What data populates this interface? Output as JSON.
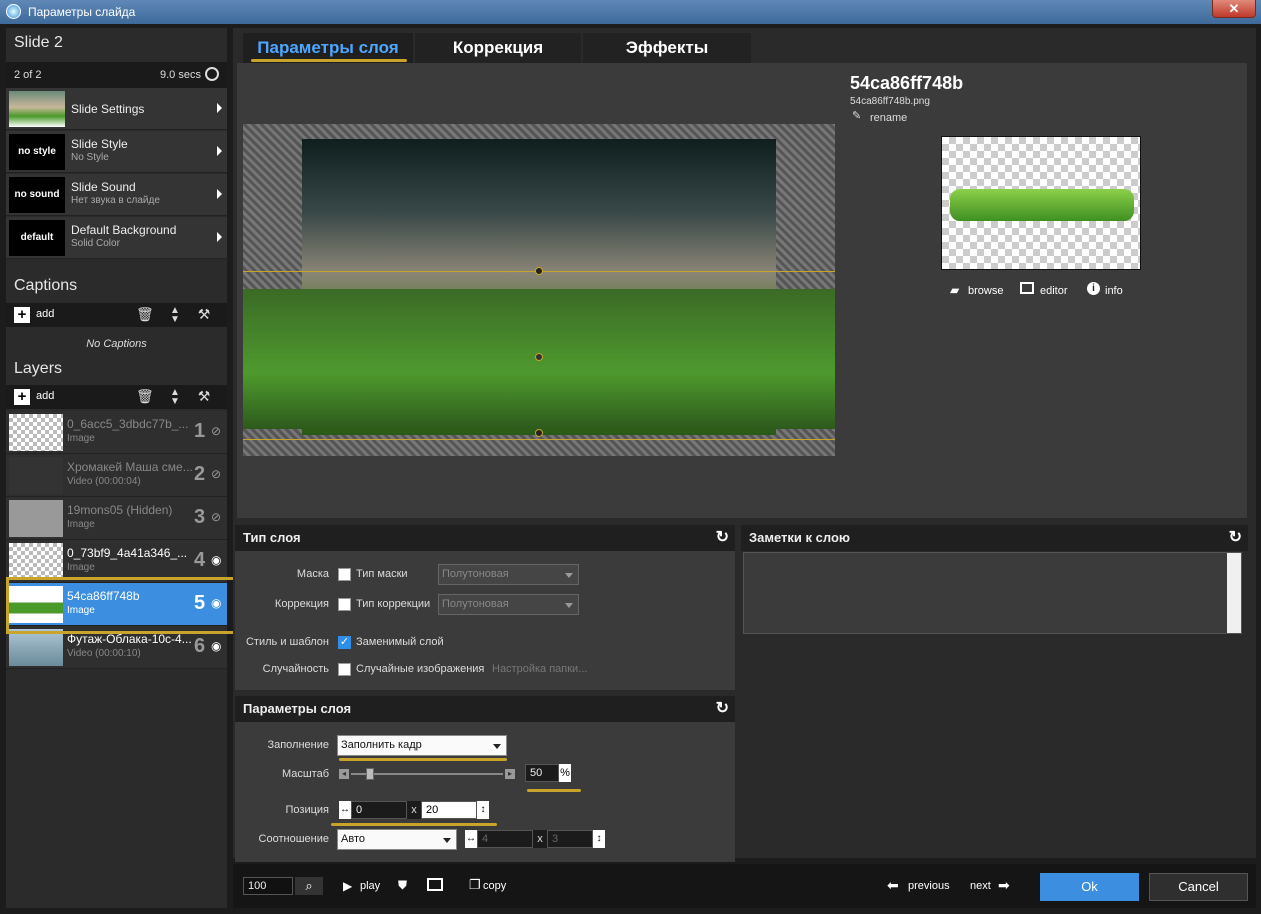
{
  "window": {
    "title": "Параметры слайда",
    "close": "✕"
  },
  "sidebar": {
    "slide_title": "Slide 2",
    "slide_index": "2 of 2",
    "slide_duration": "9.0 secs",
    "nav": [
      {
        "name": "Slide Settings",
        "sub": "",
        "thumb": ""
      },
      {
        "name": "Slide Style",
        "sub": "No Style",
        "thumb": "no style"
      },
      {
        "name": "Slide Sound",
        "sub": "Нет звука в слайде",
        "thumb": "no sound"
      },
      {
        "name": "Default Background",
        "sub": "Solid Color",
        "thumb": "default"
      }
    ],
    "captions_title": "Captions",
    "captions_add": "add",
    "captions_empty": "No Captions",
    "layers_title": "Layers",
    "layers_add": "add",
    "layers": [
      {
        "name": "0_6acc5_3dbdc77b_...",
        "type": "Image",
        "num": "1"
      },
      {
        "name": "Хромакей Маша сме...",
        "type": "Video (00:00:04)",
        "num": "2"
      },
      {
        "name": "19mons05 (Hidden)",
        "type": "Image",
        "num": "3"
      },
      {
        "name": "0_73bf9_4a41a346_...",
        "type": "Image",
        "num": "4"
      },
      {
        "name": "54ca86ff748b",
        "type": "Image",
        "num": "5"
      },
      {
        "name": "Футаж-Облака-10с-4...",
        "type": "Video (00:00:10)",
        "num": "6"
      }
    ]
  },
  "tabs": {
    "layer_params": "Параметры слоя",
    "correction": "Коррекция",
    "effects": "Эффекты"
  },
  "preview": {
    "title": "54ca86ff748b",
    "filename": "54ca86ff748b.png",
    "rename": "rename",
    "browse": "browse",
    "editor": "editor",
    "info": "info"
  },
  "layer_type": {
    "title": "Тип слоя",
    "mask_label": "Маска",
    "mask_check": "Тип маски",
    "mask_select": "Полутоновая",
    "correction_label": "Коррекция",
    "correction_check": "Тип коррекции",
    "correction_select": "Полутоновая",
    "style_label": "Стиль и шаблон",
    "style_check": "Заменимый слой",
    "random_label": "Случайность",
    "random_check": "Случайные изображения",
    "folder_settings": "Настройка папки..."
  },
  "notes": {
    "title": "Заметки к слою"
  },
  "layer_params": {
    "title": "Параметры слоя",
    "fill_label": "Заполнение",
    "fill_value": "Заполнить кадр",
    "scale_label": "Масштаб",
    "scale_value": "50",
    "scale_unit": "%",
    "scale_fraction": 0.1,
    "position_label": "Позиция",
    "pos_x": "0",
    "pos_sep": "x",
    "pos_y": "20",
    "ratio_label": "Соотношение",
    "ratio_value": "Авто",
    "ratio_w": "4",
    "ratio_sep": "x",
    "ratio_h": "3"
  },
  "bottom": {
    "zoom": "100",
    "play": "play",
    "copy": "copy",
    "previous": "previous",
    "next": "next",
    "ok": "Ok",
    "cancel": "Cancel"
  },
  "colors": {
    "accent": "#3c8fe0",
    "highlight": "#c9a42a",
    "tab_active": "#4da6ff"
  }
}
